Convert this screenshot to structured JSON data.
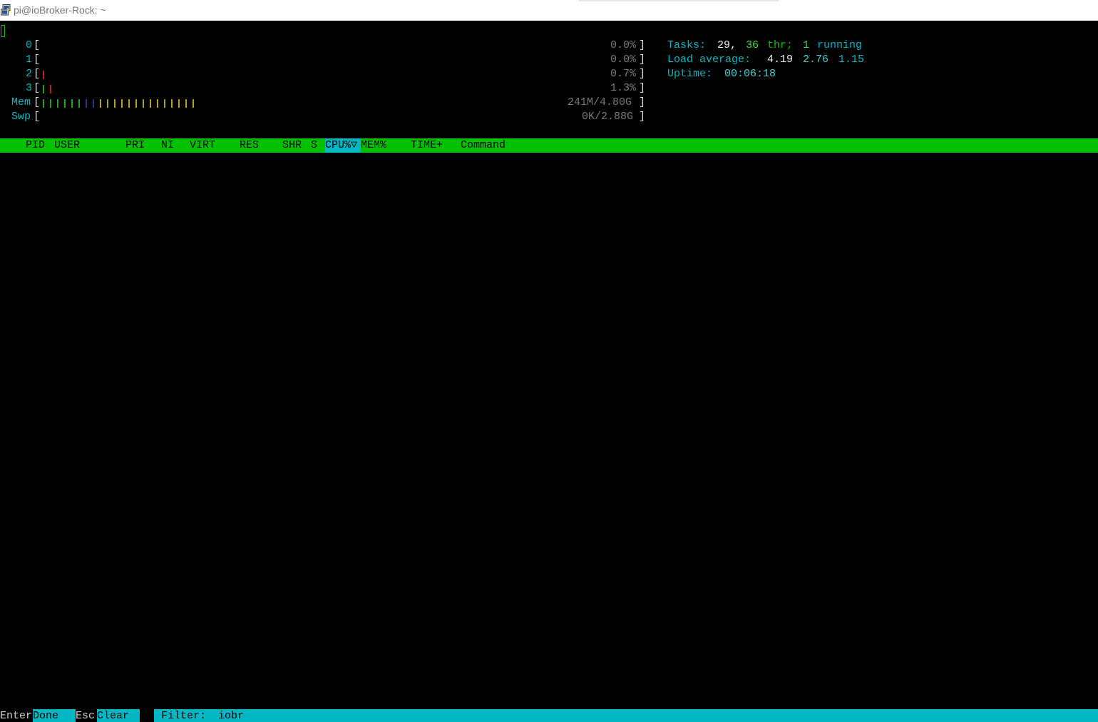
{
  "window": {
    "title": "pi@ioBroker-Rock: ~",
    "icon": "putty-icon"
  },
  "meters": {
    "cpus": [
      {
        "label": "0",
        "value": "0.0%"
      },
      {
        "label": "1",
        "value": "0.0%"
      },
      {
        "label": "2",
        "value": "0.7%"
      },
      {
        "label": "3",
        "value": "1.3%"
      }
    ],
    "mem": {
      "label": "Mem",
      "value": "241M/4.80G"
    },
    "swp": {
      "label": "Swp",
      "value": "0K/2.88G"
    },
    "open_bracket": "[",
    "close_bracket": "]"
  },
  "summary": {
    "tasks_label": "Tasks:",
    "tasks_count": "29,",
    "threads_count": "36",
    "threads_label": "thr;",
    "running_count": "1",
    "running_label": "running",
    "load_label": "Load average:",
    "load_1": "4.19",
    "load_5": "2.76",
    "load_15": "1.15",
    "uptime_label": "Uptime:",
    "uptime_value": "00:06:18"
  },
  "columns": {
    "pid": "PID",
    "user": "USER",
    "pri": "PRI",
    "ni": "NI",
    "virt": "VIRT",
    "res": "RES",
    "shr": "SHR",
    "s": "S",
    "cpu": "CPU%▽",
    "mem": "MEM%",
    "time": "TIME+",
    "command": "Command"
  },
  "footer": {
    "enter_key": "Enter",
    "enter_label": "Done",
    "esc_key": "Esc",
    "esc_label": "Clear",
    "filter_label": "Filter:",
    "filter_value": "iobr"
  },
  "colors": {
    "header_bg": "#00c000",
    "accent_cyan": "#00b7c3",
    "background": "#000000"
  }
}
